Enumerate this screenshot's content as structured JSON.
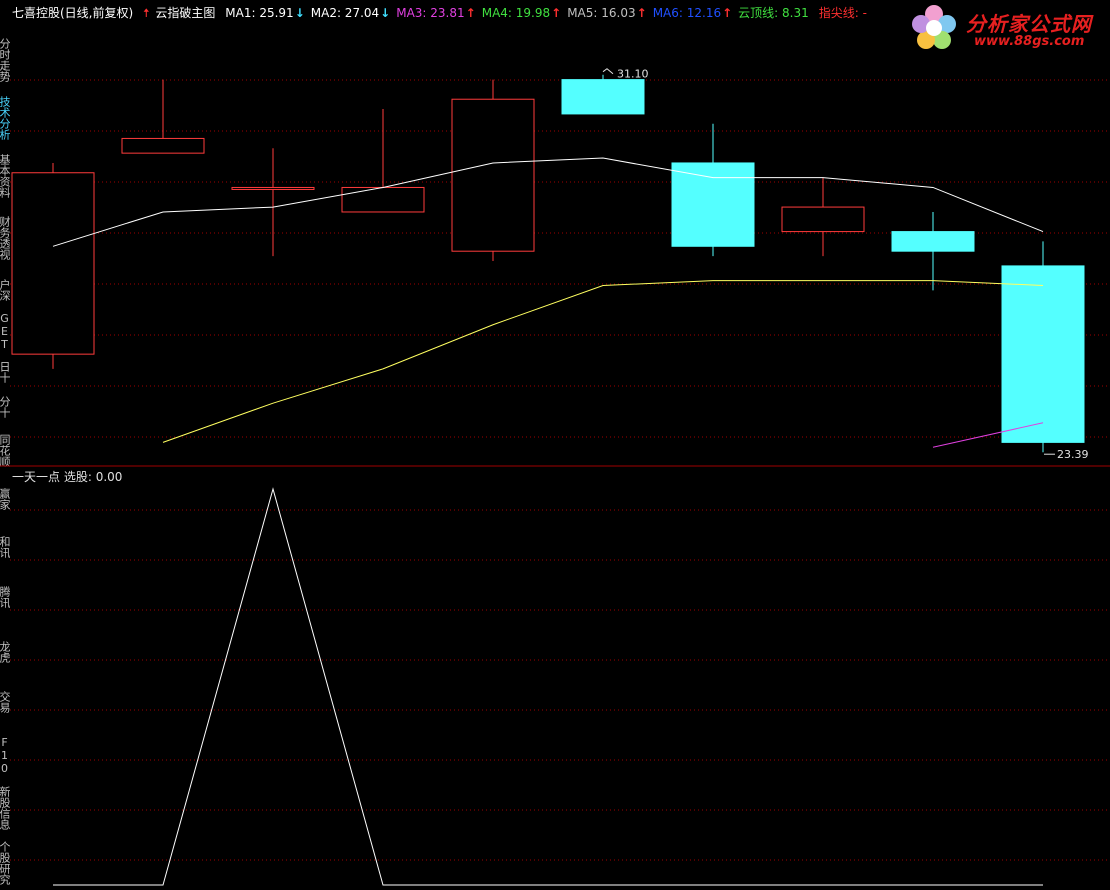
{
  "header": {
    "title": "七喜控股(日线,前复权)",
    "indicator_name": "云指破主图",
    "items": [
      {
        "label": "MA1: 25.91",
        "arrow": "↓",
        "color": "#ffffff",
        "arrow_color": "#40e0ff"
      },
      {
        "label": "MA2: 27.04",
        "arrow": "↓",
        "color": "#ffffff",
        "arrow_color": "#40e0ff"
      },
      {
        "label": "MA3: 23.81",
        "arrow": "↑",
        "color": "#e040e0",
        "arrow_color": "#ff3030"
      },
      {
        "label": "MA4: 19.98",
        "arrow": "↑",
        "color": "#40e040",
        "arrow_color": "#ff3030"
      },
      {
        "label": "MA5: 16.03",
        "arrow": "↑",
        "color": "#c0c0c0",
        "arrow_color": "#ff3030"
      },
      {
        "label": "MA6: 12.16",
        "arrow": "↑",
        "color": "#2050ff",
        "arrow_color": "#ff3030"
      },
      {
        "label": "云顶线: 8.31",
        "arrow": "",
        "color": "#40e040",
        "arrow_color": ""
      },
      {
        "label": "指尖线: -",
        "arrow": "",
        "color": "#ff3030",
        "arrow_color": ""
      }
    ]
  },
  "logo": {
    "brand": "分析家公式网",
    "url": "www.88gs.com"
  },
  "sidebar": {
    "tabs": [
      {
        "label": "分时走势",
        "active": false
      },
      {
        "label": "技术分析",
        "active": true
      },
      {
        "label": "基本资料",
        "active": false
      },
      {
        "label": "财务透视",
        "active": false
      },
      {
        "label": "户深",
        "active": false
      },
      {
        "label": "GET",
        "active": false
      },
      {
        "label": "日十",
        "active": false
      },
      {
        "label": "分十",
        "active": false
      },
      {
        "label": "同花顺",
        "active": false
      },
      {
        "label": "赢家",
        "active": false
      },
      {
        "label": "和讯",
        "active": false
      },
      {
        "label": "腾讯",
        "active": false
      },
      {
        "label": "龙虎",
        "active": false
      },
      {
        "label": "交易",
        "active": false
      },
      {
        "label": "F10",
        "active": false
      },
      {
        "label": "新股信息",
        "active": false
      },
      {
        "label": "个股研究",
        "active": false
      }
    ]
  },
  "sub_header": {
    "label": "一天一点",
    "value_label": "选股: 0.00"
  },
  "colors": {
    "up_candle": "#ff3c3c",
    "down_candle": "#54ffff",
    "ma1": "#ffffff",
    "ma2": "#ffff60",
    "ma3": "#e040e0",
    "grid": "#a00000"
  },
  "chart_data": [
    {
      "type": "candlestick",
      "title": "",
      "annotations": [
        {
          "text": "31.10",
          "type": "max"
        },
        {
          "text": "23.39",
          "type": "min"
        }
      ],
      "candles": [
        {
          "open": 25.4,
          "high": 29.3,
          "low": 25.1,
          "close": 29.1
        },
        {
          "open": 29.5,
          "high": 31.0,
          "low": 29.5,
          "close": 29.8
        },
        {
          "open": 28.8,
          "high": 29.6,
          "low": 27.4,
          "close": 28.8
        },
        {
          "open": 28.3,
          "high": 30.4,
          "low": 28.3,
          "close": 28.8
        },
        {
          "open": 27.5,
          "high": 31.0,
          "low": 27.3,
          "close": 30.6
        },
        {
          "open": 31.0,
          "high": 31.1,
          "low": 30.3,
          "close": 30.3
        },
        {
          "open": 29.3,
          "high": 30.1,
          "low": 27.4,
          "close": 27.6
        },
        {
          "open": 27.9,
          "high": 29.0,
          "low": 27.4,
          "close": 28.4
        },
        {
          "open": 27.9,
          "high": 28.3,
          "low": 26.7,
          "close": 27.5
        },
        {
          "open": 27.2,
          "high": 27.7,
          "low": 23.4,
          "close": 23.6
        }
      ],
      "series": [
        {
          "name": "MA1",
          "values": [
            27.6,
            28.3,
            28.4,
            28.8,
            29.3,
            29.4,
            29.0,
            29.0,
            28.8,
            27.9
          ]
        },
        {
          "name": "MA2",
          "values": [
            null,
            23.6,
            24.4,
            25.1,
            26.0,
            26.8,
            26.9,
            26.9,
            26.9,
            26.8
          ]
        },
        {
          "name": "MA3",
          "values": [
            null,
            null,
            null,
            null,
            null,
            null,
            null,
            null,
            23.5,
            24.0
          ]
        }
      ],
      "ylim": [
        23.2,
        31.4
      ]
    },
    {
      "type": "line",
      "title": "",
      "series": [
        {
          "name": "选股",
          "values": [
            0,
            0,
            1,
            0,
            0,
            0,
            0,
            0,
            0,
            0
          ]
        }
      ],
      "ylim": [
        0,
        1
      ]
    }
  ]
}
